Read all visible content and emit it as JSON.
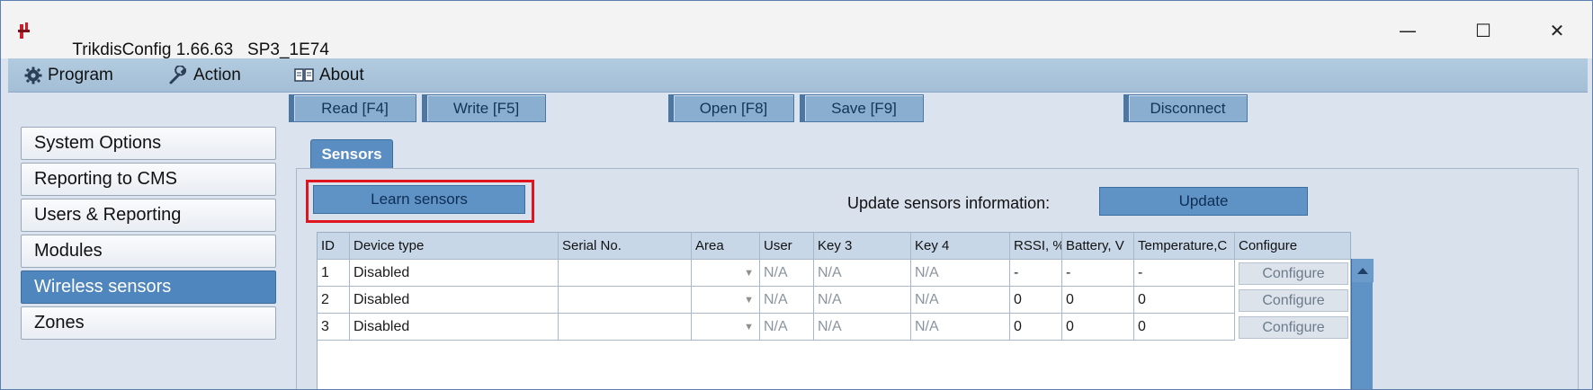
{
  "window": {
    "title": "TrikdisConfig 1.66.63",
    "device": "SP3_1E74",
    "minimize_glyph": "—",
    "maximize_glyph": "☐",
    "close_glyph": "✕"
  },
  "menu": {
    "program": "Program",
    "action": "Action",
    "about": "About"
  },
  "toolbar": {
    "read": "Read [F4]",
    "write": "Write [F5]",
    "open": "Open [F8]",
    "save": "Save [F9]",
    "disconnect": "Disconnect"
  },
  "sidebar": {
    "items": [
      {
        "label": "System Options"
      },
      {
        "label": "Reporting to CMS"
      },
      {
        "label": "Users & Reporting"
      },
      {
        "label": "Modules"
      },
      {
        "label": "Wireless sensors"
      },
      {
        "label": "Zones"
      }
    ],
    "active_index": 4
  },
  "tab": {
    "label": "Sensors"
  },
  "sensors": {
    "learn_button": "Learn sensors",
    "update_label": "Update sensors information:",
    "update_button": "Update",
    "columns": [
      "ID",
      "Device type",
      "Serial No.",
      "Area",
      "User",
      "Key 3",
      "Key 4",
      "RSSI, %",
      "Battery, V",
      "Temperature,C",
      "Configure"
    ],
    "rows": [
      {
        "id": "1",
        "device_type": "Disabled",
        "serial": "",
        "area": "",
        "user": "N/A",
        "key3": "N/A",
        "key4": "N/A",
        "rssi": "-",
        "battery": "-",
        "temperature": "-",
        "configure": "Configure"
      },
      {
        "id": "2",
        "device_type": "Disabled",
        "serial": "",
        "area": "",
        "user": "N/A",
        "key3": "N/A",
        "key4": "N/A",
        "rssi": "0",
        "battery": "0",
        "temperature": "0",
        "configure": "Configure"
      },
      {
        "id": "3",
        "device_type": "Disabled",
        "serial": "",
        "area": "",
        "user": "N/A",
        "key3": "N/A",
        "key4": "N/A",
        "rssi": "0",
        "battery": "0",
        "temperature": "0",
        "configure": "Configure"
      }
    ]
  },
  "colors": {
    "accent": "#5f93c6",
    "highlight": "#e0141e",
    "menubar": "#a3bed6"
  }
}
